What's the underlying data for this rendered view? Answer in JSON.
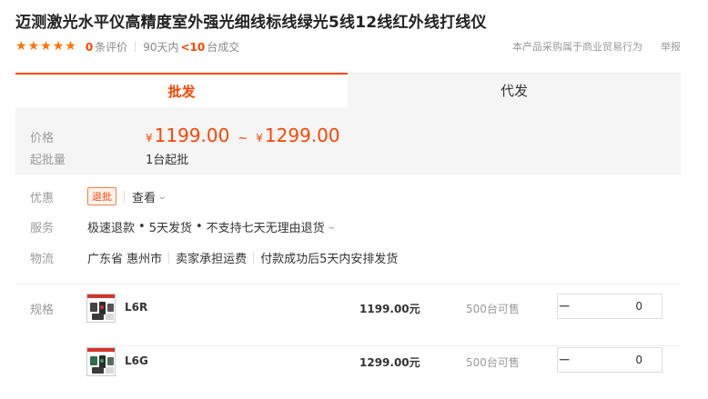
{
  "product": {
    "title": "迈测激光水平仪高精度室外强光细线标线绿光5线12线红外线打线仪",
    "rating_stars": 5,
    "review_count": "0",
    "review_unit": "条评价",
    "deal_prefix": "90天内",
    "deal_count": "<10",
    "deal_suffix": "台成交",
    "notice": "本产品采购属于商业贸易行为",
    "report": "举报"
  },
  "tabs": [
    {
      "label": "批发",
      "active": true
    },
    {
      "label": "代发",
      "active": false
    }
  ],
  "price": {
    "label": "价格",
    "currency": "¥",
    "low": "1199.00",
    "separator": "~",
    "high": "1299.00",
    "moq_label": "起批量",
    "moq_value": "1台起批"
  },
  "promo": {
    "label": "优惠",
    "badge": "退批",
    "link": "查看"
  },
  "service": {
    "label": "服务",
    "items": [
      "极速退款",
      "5天发货",
      "不支持七天无理由退货"
    ]
  },
  "logistics": {
    "label": "物流",
    "origin": "广东省 惠州市",
    "freight": "卖家承担运费",
    "ship_time": "付款成功后5天内安排发货"
  },
  "specs": {
    "label": "规格",
    "items": [
      {
        "name": "L6R",
        "price": "1199.00元",
        "stock": "500台可售",
        "quantity": "0"
      },
      {
        "name": "L6G",
        "price": "1299.00元",
        "stock": "500台可售",
        "quantity": "0"
      }
    ]
  },
  "icons": {
    "star": "star-icon",
    "chevron": "chevron-down-icon",
    "minus": "minus-icon",
    "plus": "plus-icon"
  },
  "colors": {
    "accent": "#ff4400",
    "star": "#ff7300",
    "panel_bg": "#f5f5f5"
  }
}
